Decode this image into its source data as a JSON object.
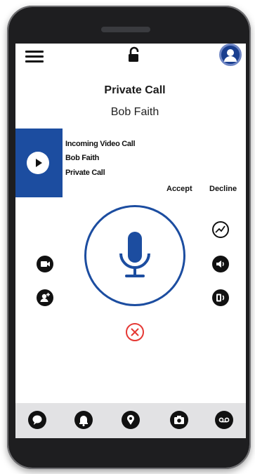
{
  "call": {
    "type_label": "Private Call",
    "caller_name": "Bob Faith"
  },
  "notification": {
    "line1": "Incoming Video Call",
    "line2": "Bob Faith",
    "line3": "Private Call"
  },
  "actions": {
    "accept_label": "Accept",
    "decline_label": "Decline"
  },
  "icons": {
    "top_bar": [
      "menu-icon",
      "lock-open-icon",
      "user-avatar-icon"
    ],
    "notification": [
      "play-icon"
    ],
    "center": [
      "microphone-icon",
      "end-call-icon"
    ],
    "left_side": [
      "video-camera-icon",
      "add-user-icon"
    ],
    "right_side": [
      "signal-trend-icon",
      "speaker-volume-icon",
      "phone-switch-icon"
    ],
    "bottom_nav": [
      "chat-icon",
      "alert-bell-icon",
      "location-pin-icon",
      "camera-icon",
      "voicemail-icon"
    ]
  },
  "colors": {
    "accent": "#1c4da0",
    "end_call": "#e53935",
    "nav_background": "#e2e2e4",
    "phone_body": "#1e1e20"
  }
}
